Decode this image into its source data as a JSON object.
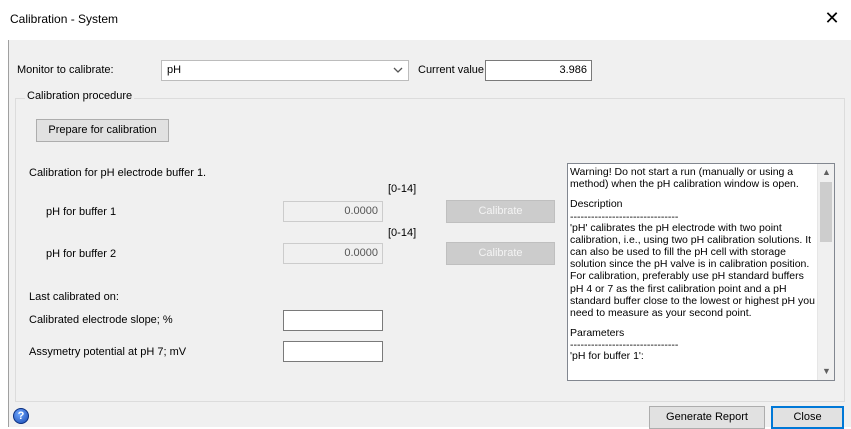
{
  "window": {
    "title": "Calibration - System",
    "close_glyph": "✕"
  },
  "monitor": {
    "label": "Monitor to calibrate:",
    "selected": "pH",
    "current_value_label": "Current value",
    "current_value": "3.986"
  },
  "group": {
    "title": "Calibration procedure",
    "prepare_button": "Prepare for calibration",
    "instruction": "Calibration for pH electrode buffer 1.",
    "buffer1": {
      "range": "[0-14]",
      "label": "pH for buffer 1",
      "value": "0.0000",
      "calibrate_label": "Calibrate"
    },
    "buffer2": {
      "range": "[0-14]",
      "label": "pH for buffer 2",
      "value": "0.0000",
      "calibrate_label": "Calibrate"
    },
    "last_calibrated_label": "Last calibrated on:",
    "slope_label": "Calibrated electrode slope; %",
    "slope_value": "",
    "asym_label": "Assymetry potential at pH 7; mV",
    "asym_value": ""
  },
  "description": {
    "warning": "Warning! Do not start a run (manually or using a method) when the pH calibration window is open.",
    "heading": "Description",
    "separator": "-------------------------------",
    "body": "'pH' calibrates the pH electrode with two point calibration, i.e., using two pH calibration solutions. It can also be used to fill the pH cell with storage solution since the pH valve is in calibration position. For calibration, preferably use pH standard buffers pH 4 or 7 as the first calibration point and a pH standard buffer close to the lowest or highest pH you need to measure as your second point.",
    "params_heading": "Parameters",
    "params_separator": "-------------------------------",
    "params_first": "'pH for buffer 1':"
  },
  "footer": {
    "help_glyph": "?",
    "generate_report": "Generate Report",
    "close": "Close"
  },
  "icons": {
    "close": "close-icon",
    "dropdown": "chevron-down-icon",
    "help": "help-icon",
    "scroll_up": "scroll-up-icon",
    "scroll_down": "scroll-down-icon"
  },
  "colors": {
    "dialog_bg": "#f0f0f0",
    "default_button_border": "#0078d7",
    "help_icon": "#1747b0"
  }
}
